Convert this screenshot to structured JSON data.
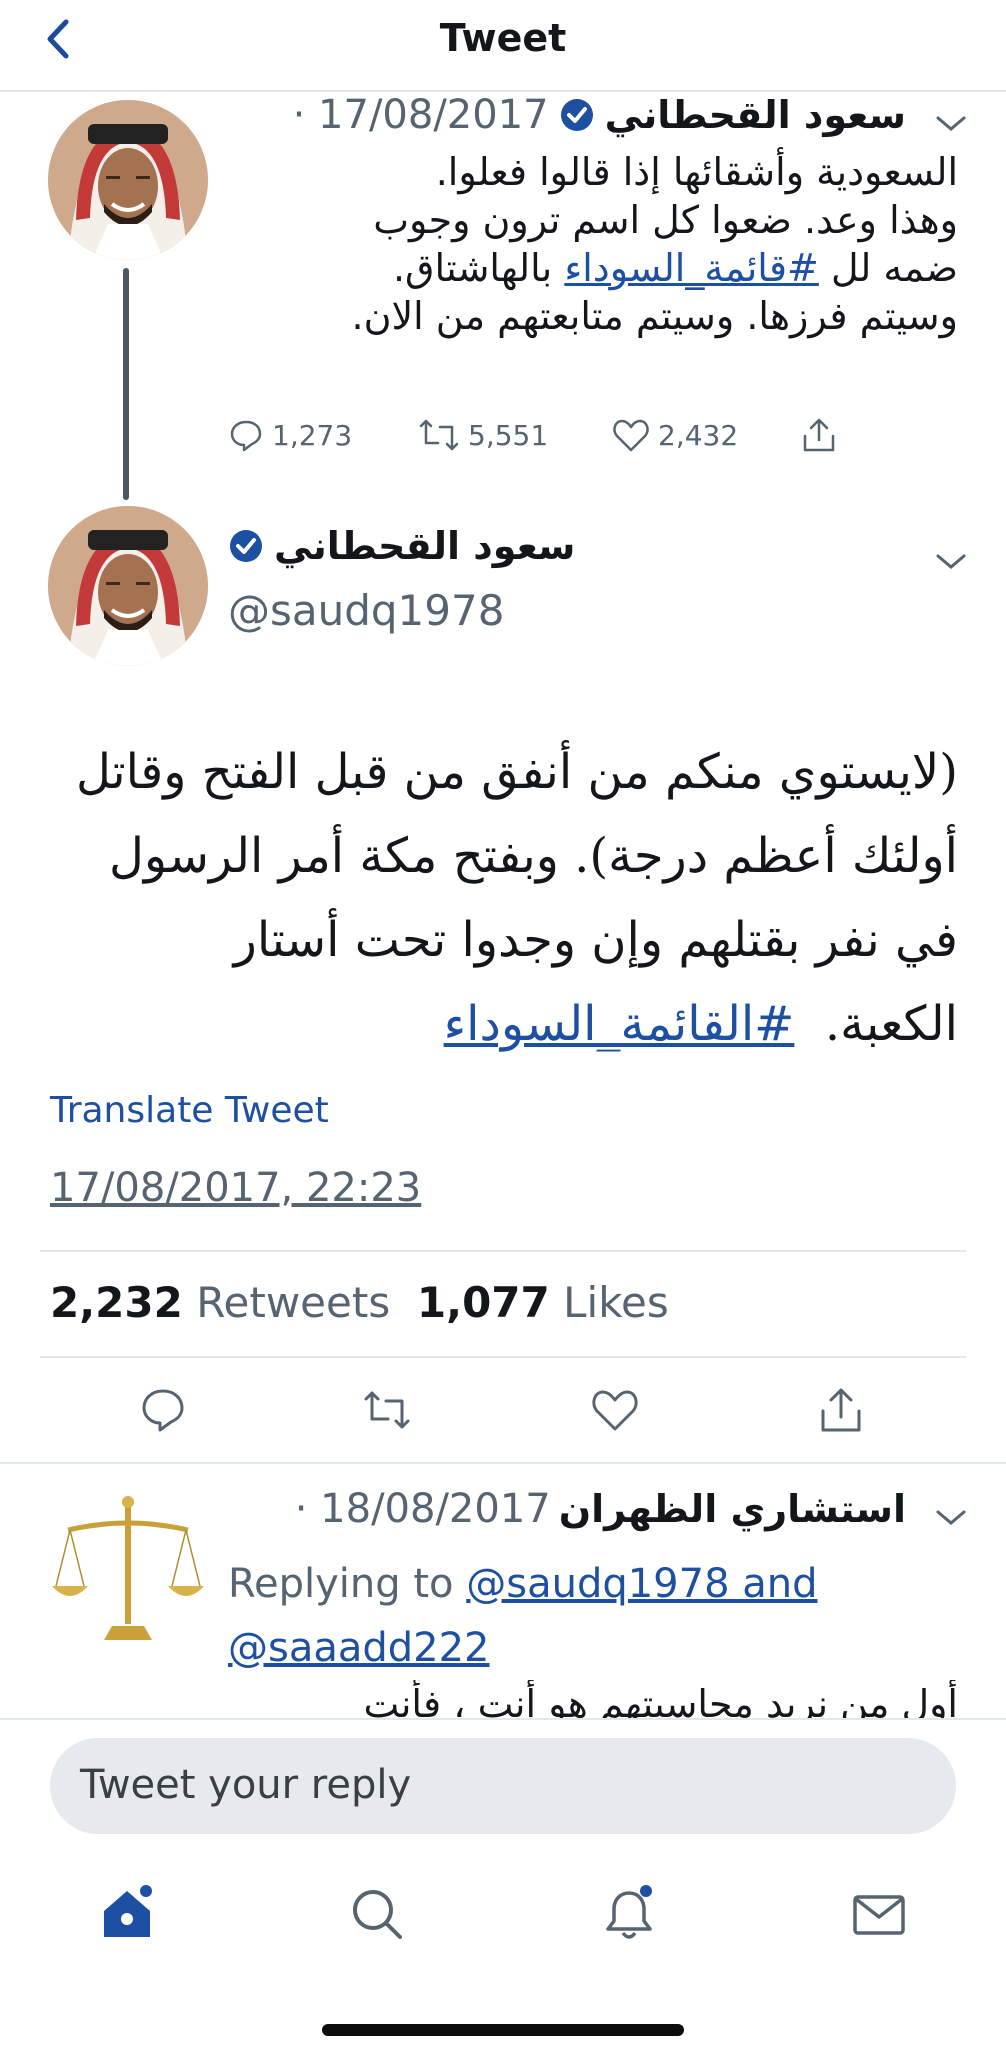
{
  "header": {
    "title": "Tweet"
  },
  "tweet1": {
    "name": "سعود القحطاني",
    "date": "· 17/08/2017",
    "text_lines": [
      "السعودية وأشقائها إذا قالوا فعلوا.",
      "وهذا وعد. ضعوا كل اسم ترون وجوب",
      "بالهاشتاق.",
      "وسيتم فرزها. وسيتم متابعتهم من الان."
    ],
    "line3_prefix": "ضمه لل",
    "hashtag": "#قائمة_السوداء",
    "replies": "1,273",
    "retweets": "5,551",
    "likes": "2,432"
  },
  "main_tweet": {
    "name": "سعود القحطاني",
    "handle": "@saudq1978",
    "text_lines": [
      "(لايستوي منكم من أنفق من قبل الفتح وقاتل",
      "أولئك أعظم درجة). وبفتح مكة أمر الرسول",
      "في نفر بقتلهم وإن وجدوا تحت أستار",
      "الكعبة."
    ],
    "hashtag": "#القائمة_السوداء",
    "translate_label": "Translate Tweet",
    "timestamp": "17/08/2017, 22:23",
    "retweets_count": "2,232",
    "retweets_label": "Retweets",
    "likes_count": "1,077",
    "likes_label": "Likes"
  },
  "reply": {
    "name": "استشاري الظهران",
    "date": "· 18/08/2017",
    "replying_prefix": "Replying to",
    "replying_line1": "@saudq1978 and",
    "replying_line2": "@saaadd222",
    "text": "أول من نريد محاسبتهم هو أنت ، فأنت"
  },
  "composer": {
    "placeholder": "Tweet your reply"
  },
  "icons": [
    "back-chevron-icon",
    "verified-icon",
    "reply-icon",
    "retweet-icon",
    "like-icon",
    "share-icon",
    "home-icon",
    "search-icon",
    "notifications-icon",
    "messages-icon"
  ],
  "colors": {
    "accent": "#1d4fa2",
    "muted": "#566370",
    "divider": "#e1e8ed"
  }
}
